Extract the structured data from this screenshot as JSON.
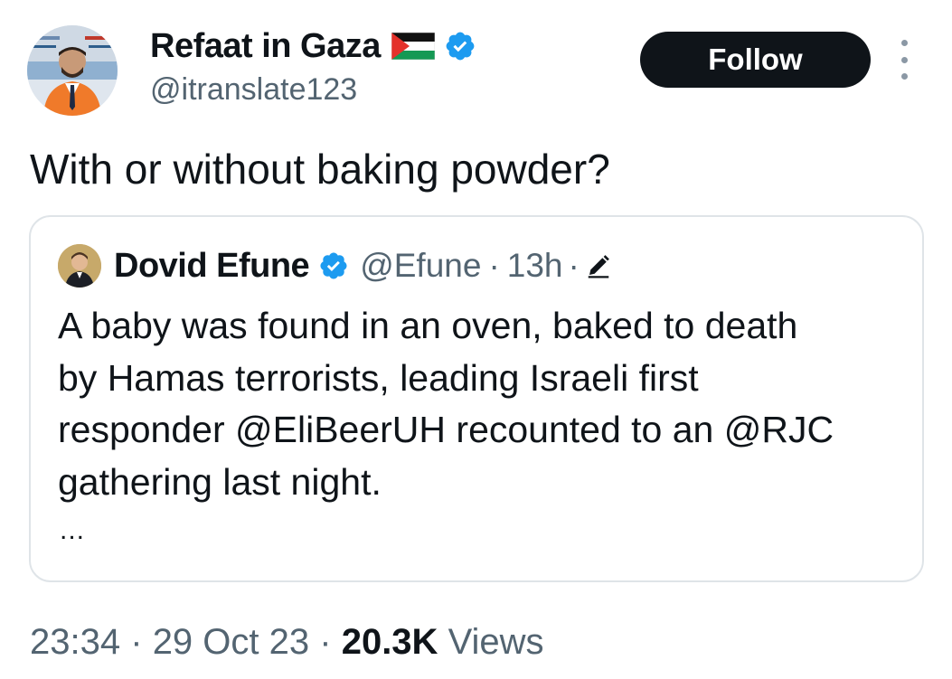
{
  "author": {
    "name": "Refaat in Gaza",
    "handle": "@itranslate123",
    "flag_icon": "palestine-flag-icon",
    "verified_icon": "verified-badge-icon"
  },
  "follow_label": "Follow",
  "more_icon": "more-options-icon",
  "tweet_text": "With or without baking powder?",
  "quote": {
    "author_name": "Dovid Efune",
    "handle": "@Efune",
    "separator": "·",
    "time": "13h",
    "edit_icon": "edit-pencil-icon",
    "body_lines": [
      "A baby was found in an oven, baked to death",
      "by Hamas terrorists, leading Israeli first",
      "responder @EliBeerUH recounted to an @RJC",
      "gathering last night."
    ],
    "ellipsis": "..."
  },
  "meta": {
    "time": "23:34",
    "separator": "·",
    "date": "29 Oct 23",
    "views_count": "20.3K",
    "views_label": "Views"
  },
  "colors": {
    "text_primary": "#0f1419",
    "text_secondary": "#536471",
    "verified_blue": "#1d9bf0",
    "border": "#dfe4e8"
  }
}
